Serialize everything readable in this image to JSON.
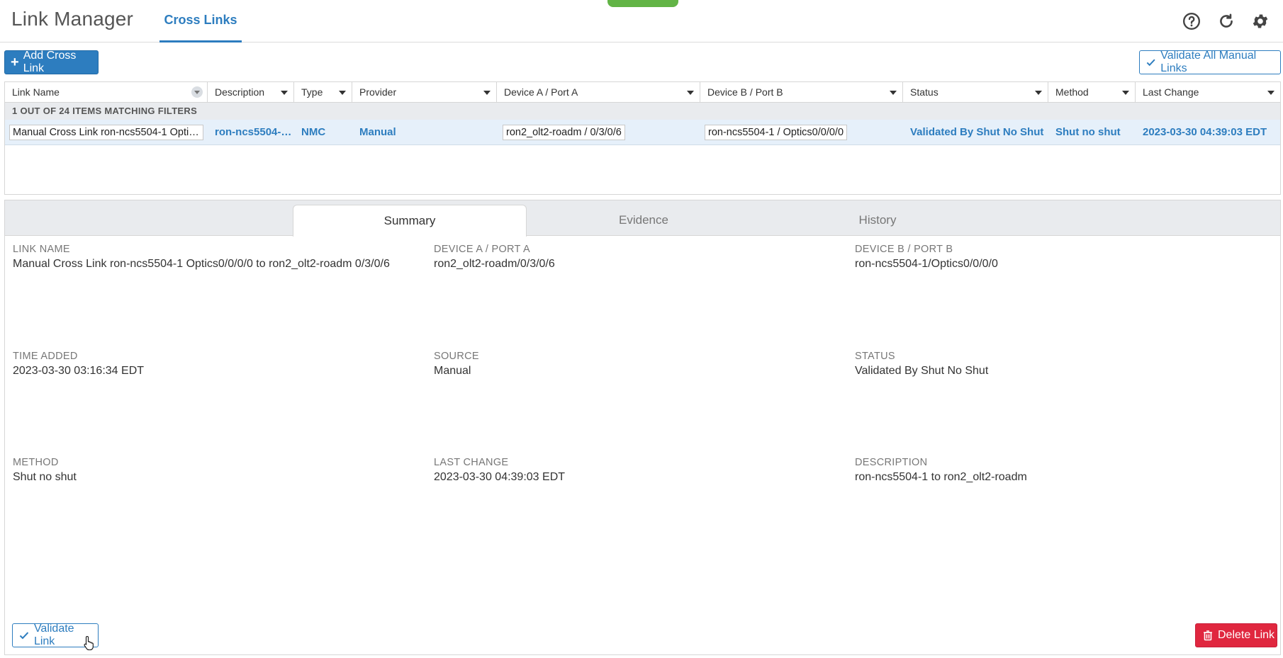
{
  "header": {
    "app_title": "Link Manager",
    "tab_label": "Cross Links",
    "icons": [
      "help-icon",
      "refresh-icon",
      "gear-icon"
    ]
  },
  "toolbar": {
    "add_label": "Add Cross Link",
    "validate_all_label": "Validate All Manual Links"
  },
  "table": {
    "columns": [
      "Link Name",
      "Description",
      "Type",
      "Provider",
      "Device A / Port A",
      "Device B / Port B",
      "Status",
      "Method",
      "Last Change"
    ],
    "matching_text": "1 OUT OF 24 ITEMS MATCHING FILTERS",
    "rows": [
      {
        "link_name": "Manual Cross Link ron-ncs5504-1 Optic…",
        "description": "ron-ncs5504-…",
        "type": "NMC",
        "provider": "Manual",
        "device_a": "ron2_olt2-roadm / 0/3/0/6",
        "device_b": "ron-ncs5504-1 / Optics0/0/0/0",
        "status": "Validated By Shut No Shut",
        "method": "Shut no shut",
        "last_change": "2023-03-30 04:39:03 EDT"
      }
    ]
  },
  "detail": {
    "tabs": [
      "Summary",
      "Evidence",
      "History"
    ],
    "active_tab": "Summary",
    "fields": {
      "link_name": {
        "label": "LINK NAME",
        "value": "Manual Cross Link ron-ncs5504-1 Optics0/0/0/0 to ron2_olt2-roadm 0/3/0/6"
      },
      "device_a": {
        "label": "DEVICE A / PORT A",
        "value": "ron2_olt2-roadm/0/3/0/6"
      },
      "device_b": {
        "label": "DEVICE B / PORT B",
        "value": "ron-ncs5504-1/Optics0/0/0/0"
      },
      "time_added": {
        "label": "TIME ADDED",
        "value": "2023-03-30 03:16:34 EDT"
      },
      "source": {
        "label": "SOURCE",
        "value": "Manual"
      },
      "status": {
        "label": "STATUS",
        "value": "Validated By Shut No Shut"
      },
      "method": {
        "label": "METHOD",
        "value": "Shut no shut"
      },
      "last_change": {
        "label": "LAST CHANGE",
        "value": "2023-03-30 04:39:03 EDT"
      },
      "description": {
        "label": "DESCRIPTION",
        "value": "ron-ncs5504-1 to ron2_olt2-roadm"
      }
    },
    "validate_label": "Validate Link",
    "delete_label": "Delete Link"
  },
  "colors": {
    "accent": "#2d7dbf",
    "danger": "#e0273f",
    "selected_row": "#e6f0fa",
    "status_indicator": "#62b446"
  }
}
